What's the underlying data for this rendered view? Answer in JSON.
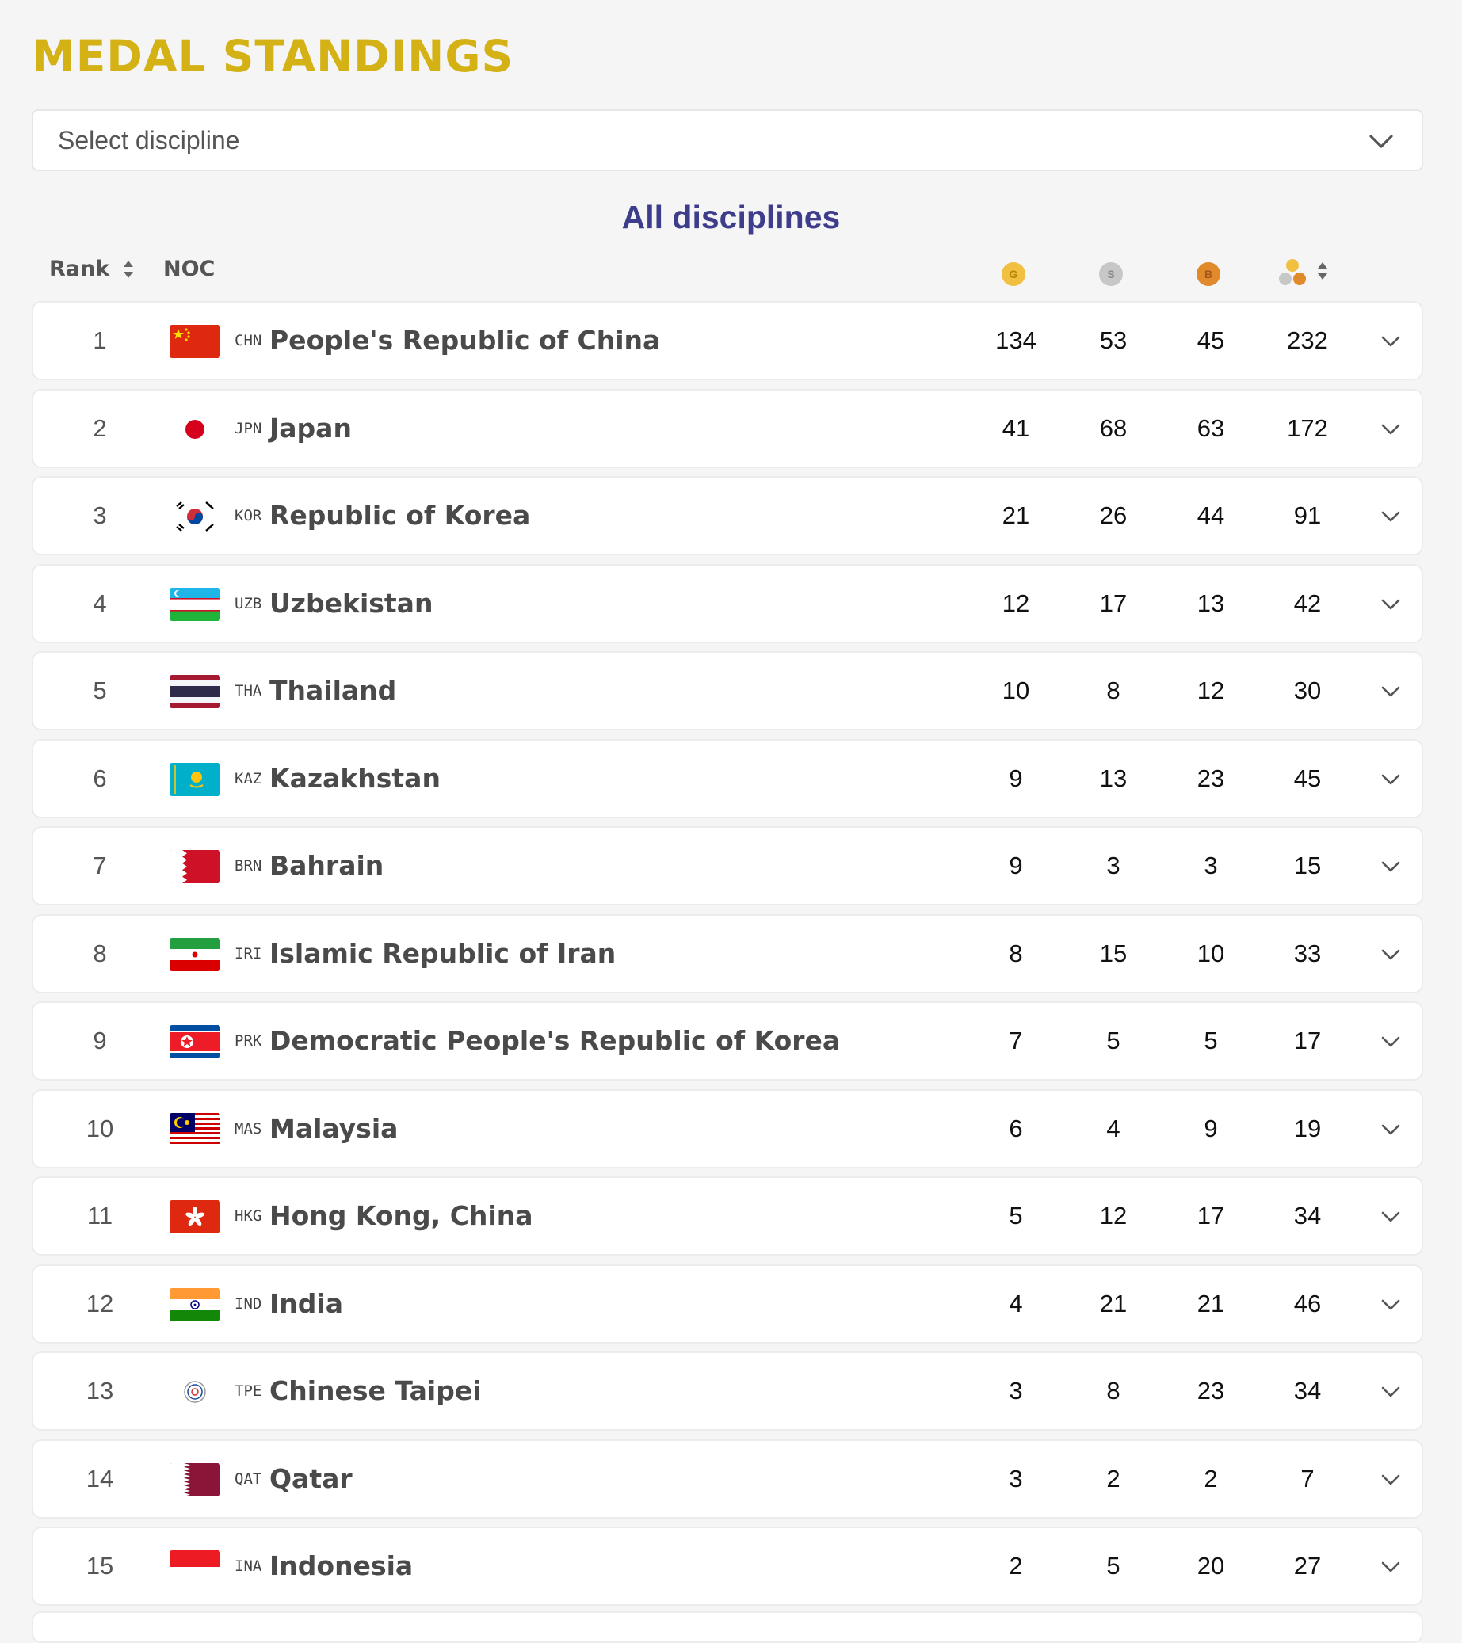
{
  "page": {
    "title": "MEDAL STANDINGS",
    "select": {
      "placeholder": "Select discipline",
      "icon": "chevron-down-icon"
    },
    "section_title": "All disciplines"
  },
  "table": {
    "columns": {
      "rank": "Rank",
      "noc": "NOC",
      "gold_letter": "G",
      "silver_letter": "S",
      "bronze_letter": "B"
    },
    "colors": {
      "gold": "#f1c040",
      "silver": "#c7c7c7",
      "bronze": "#e08a2c",
      "title": "#d4b216",
      "heading": "#3e3d8c"
    },
    "rows": [
      {
        "rank": "1",
        "code": "CHN",
        "name": "People's Republic of China",
        "gold": "134",
        "silver": "53",
        "bronze": "45",
        "total": "232"
      },
      {
        "rank": "2",
        "code": "JPN",
        "name": "Japan",
        "gold": "41",
        "silver": "68",
        "bronze": "63",
        "total": "172"
      },
      {
        "rank": "3",
        "code": "KOR",
        "name": "Republic of Korea",
        "gold": "21",
        "silver": "26",
        "bronze": "44",
        "total": "91"
      },
      {
        "rank": "4",
        "code": "UZB",
        "name": "Uzbekistan",
        "gold": "12",
        "silver": "17",
        "bronze": "13",
        "total": "42"
      },
      {
        "rank": "5",
        "code": "THA",
        "name": "Thailand",
        "gold": "10",
        "silver": "8",
        "bronze": "12",
        "total": "30"
      },
      {
        "rank": "6",
        "code": "KAZ",
        "name": "Kazakhstan",
        "gold": "9",
        "silver": "13",
        "bronze": "23",
        "total": "45"
      },
      {
        "rank": "7",
        "code": "BRN",
        "name": "Bahrain",
        "gold": "9",
        "silver": "3",
        "bronze": "3",
        "total": "15"
      },
      {
        "rank": "8",
        "code": "IRI",
        "name": "Islamic Republic of Iran",
        "gold": "8",
        "silver": "15",
        "bronze": "10",
        "total": "33"
      },
      {
        "rank": "9",
        "code": "PRK",
        "name": "Democratic People's Republic of Korea",
        "gold": "7",
        "silver": "5",
        "bronze": "5",
        "total": "17"
      },
      {
        "rank": "10",
        "code": "MAS",
        "name": "Malaysia",
        "gold": "6",
        "silver": "4",
        "bronze": "9",
        "total": "19"
      },
      {
        "rank": "11",
        "code": "HKG",
        "name": "Hong Kong, China",
        "gold": "5",
        "silver": "12",
        "bronze": "17",
        "total": "34"
      },
      {
        "rank": "12",
        "code": "IND",
        "name": "India",
        "gold": "4",
        "silver": "21",
        "bronze": "21",
        "total": "46"
      },
      {
        "rank": "13",
        "code": "TPE",
        "name": "Chinese Taipei",
        "gold": "3",
        "silver": "8",
        "bronze": "23",
        "total": "34"
      },
      {
        "rank": "14",
        "code": "QAT",
        "name": "Qatar",
        "gold": "3",
        "silver": "2",
        "bronze": "2",
        "total": "7"
      },
      {
        "rank": "15",
        "code": "INA",
        "name": "Indonesia",
        "gold": "2",
        "silver": "5",
        "bronze": "20",
        "total": "27"
      }
    ]
  }
}
